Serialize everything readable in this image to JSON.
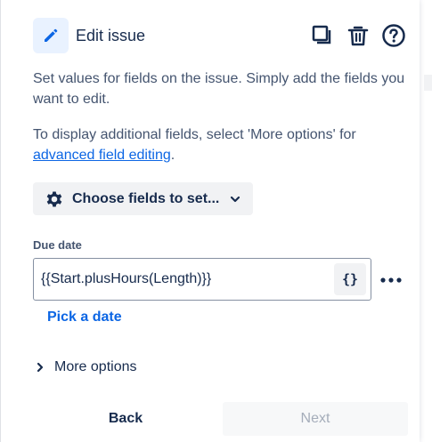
{
  "header": {
    "title": "Edit issue",
    "icon": "pencil-icon",
    "actions": [
      "copy-icon",
      "trash-icon",
      "help-icon"
    ]
  },
  "description": {
    "line1": "Set values for fields on the issue. Simply add the fields you want to edit.",
    "line2_prefix": "To display additional fields, select 'More options' for ",
    "line2_link": "advanced field editing",
    "line2_suffix": "."
  },
  "choose_fields": {
    "label": "Choose fields to set...",
    "icon": "gear-icon"
  },
  "due_date": {
    "label": "Due date",
    "value": "{{Start.plusHours(Length)}}",
    "smart_value_label": "{}",
    "pick_date_label": "Pick a date"
  },
  "more_options": {
    "label": "More options"
  },
  "footer": {
    "back_label": "Back",
    "next_label": "Next"
  },
  "colors": {
    "accent": "#0c66e4",
    "text": "#172b4d",
    "subtle_text": "#44546f",
    "button_bg": "#f1f2f4",
    "disabled_text": "#a5adba"
  }
}
